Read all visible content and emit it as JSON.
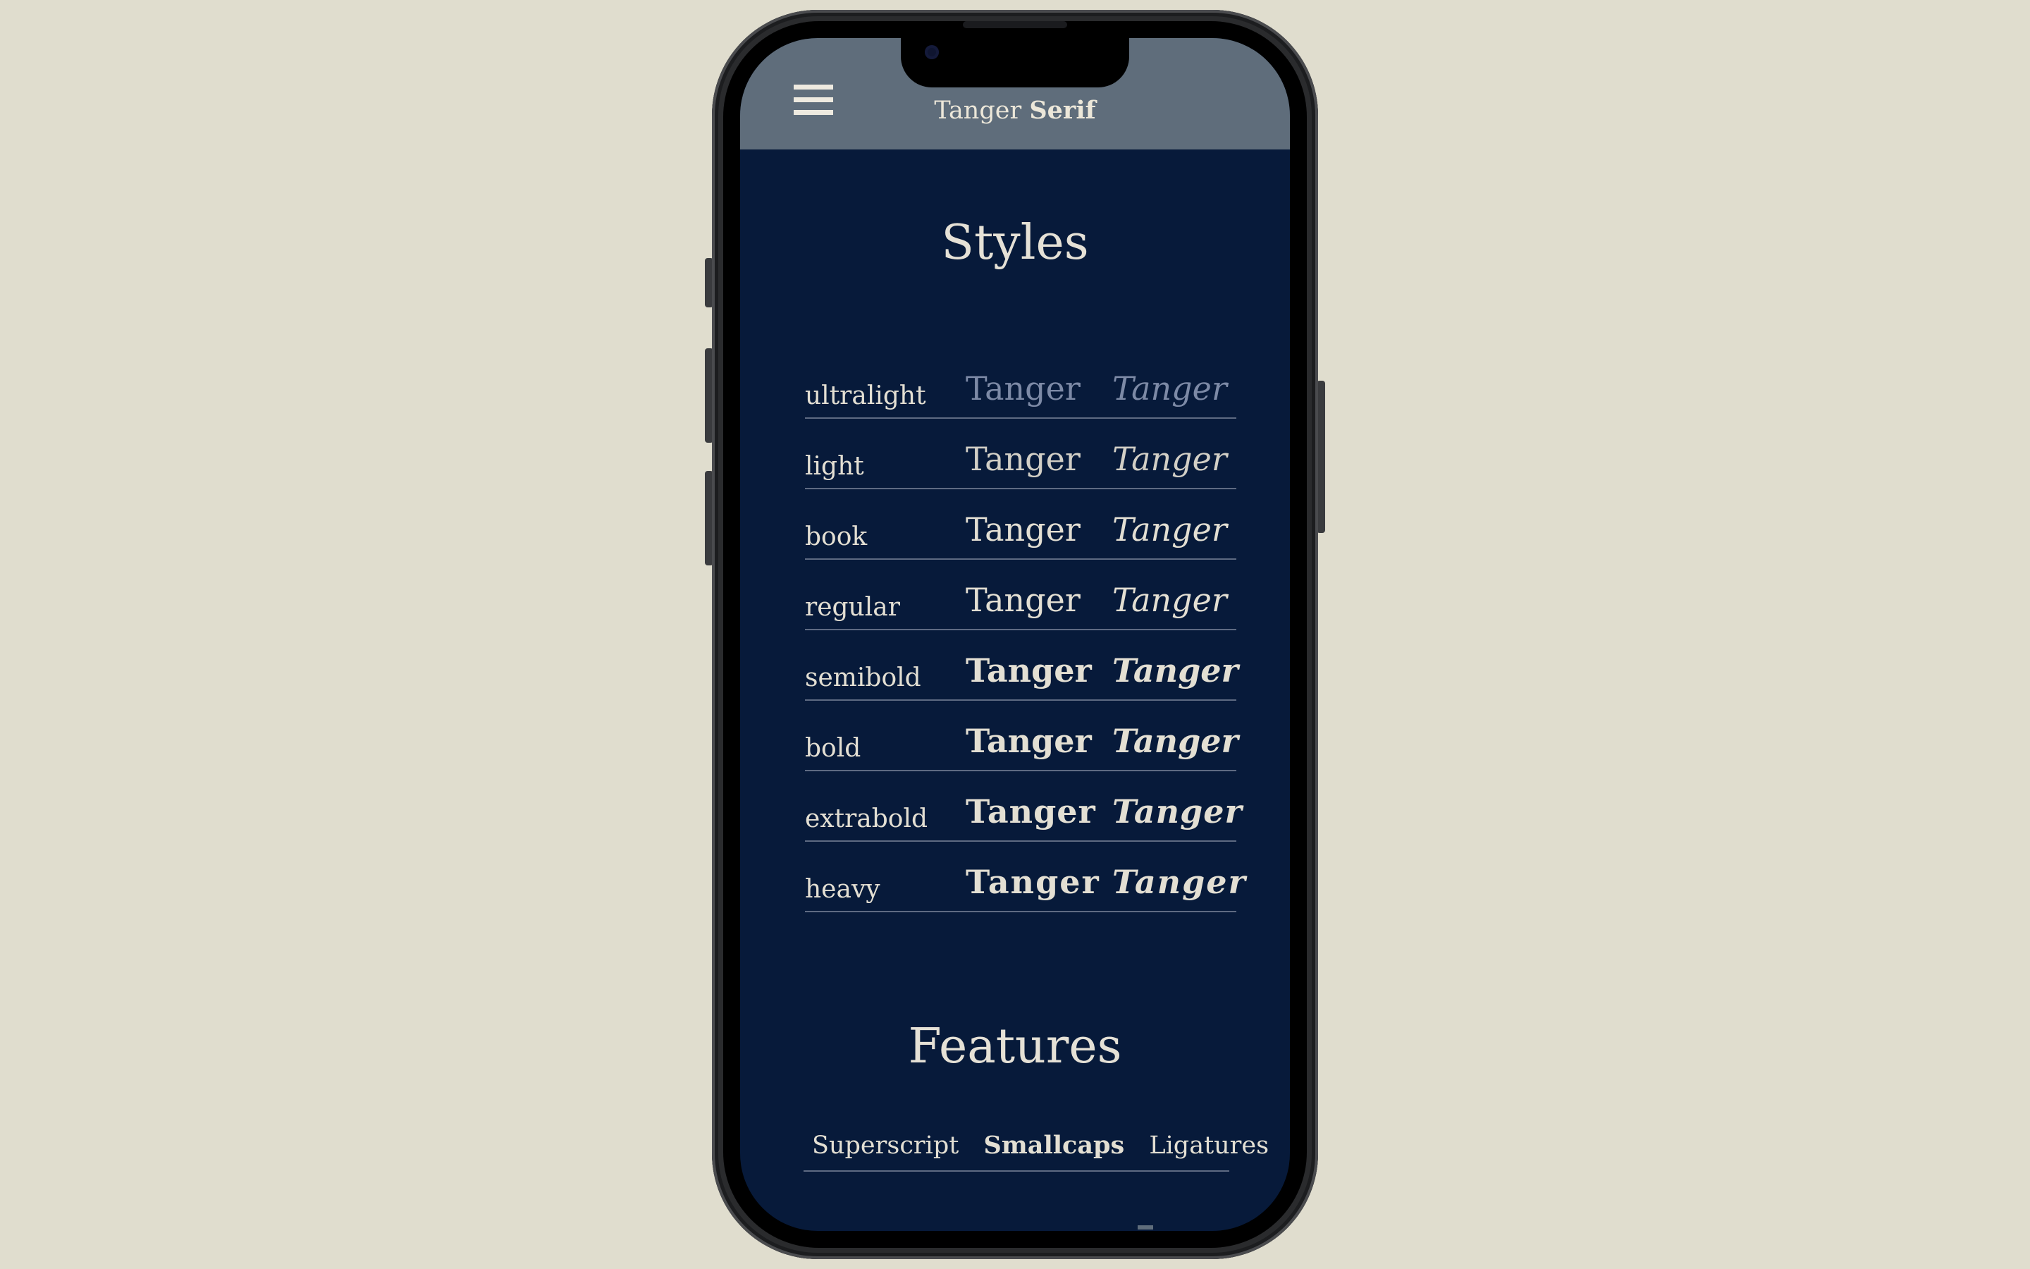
{
  "header": {
    "brand_regular": "Tanger",
    "brand_bold": "Serif",
    "menu_icon": "hamburger-menu-icon"
  },
  "styles": {
    "title": "Styles",
    "rows": [
      {
        "label": "ultralight",
        "roman": "Tanger",
        "italic": "Tanger"
      },
      {
        "label": "light",
        "roman": "Tanger",
        "italic": "Tanger"
      },
      {
        "label": "book",
        "roman": "Tanger",
        "italic": "Tanger"
      },
      {
        "label": "regular",
        "roman": "Tanger",
        "italic": "Tanger"
      },
      {
        "label": "semibold",
        "roman": "Tanger",
        "italic": "Tanger"
      },
      {
        "label": "bold",
        "roman": "Tanger",
        "italic": "Tanger"
      },
      {
        "label": "extrabold",
        "roman": "Tanger",
        "italic": "Tanger"
      },
      {
        "label": "heavy",
        "roman": "Tanger",
        "italic": "Tanger"
      }
    ]
  },
  "features": {
    "title": "Features",
    "tabs": [
      {
        "label": "Superscript",
        "active": false
      },
      {
        "label": "Smallcaps",
        "active": true
      },
      {
        "label": "Ligatures",
        "active": false
      }
    ]
  },
  "colors": {
    "page_background": "#e0ddce",
    "header_background": "#5f6d7b",
    "screen_background": "#071a3a",
    "text": "#e3dfd3",
    "divider": "#5e6a82"
  }
}
